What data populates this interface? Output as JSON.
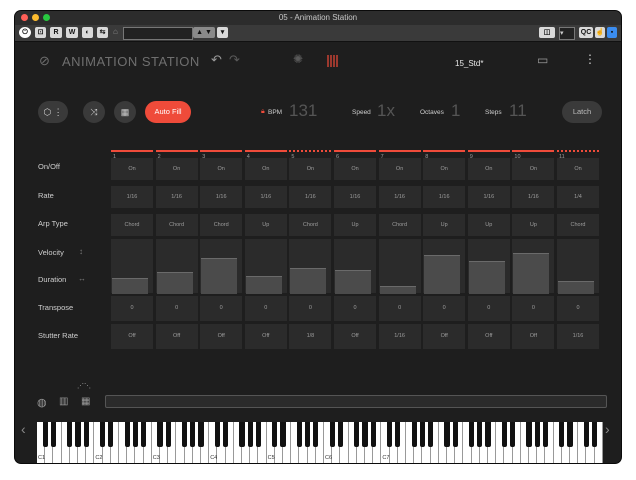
{
  "window": {
    "title": "05 - Animation Station"
  },
  "toolbar": {
    "buttons": [
      "R",
      "W"
    ],
    "qc_label": "QC"
  },
  "header": {
    "app_name": "ANIMATION STATION",
    "preset_name": "15_Std*"
  },
  "controls": {
    "auto_fill_label": "Auto Fill",
    "latch_label": "Latch",
    "bpm_label": "BPM",
    "bpm_value": "131",
    "speed_label": "Speed",
    "speed_value": "1x",
    "octaves_label": "Octaves",
    "octaves_value": "1",
    "steps_label": "Steps",
    "steps_value": "11"
  },
  "rows": {
    "on_off": "On/Off",
    "rate": "Rate",
    "arp_type": "Arp Type",
    "velocity": "Velocity",
    "duration": "Duration",
    "transpose": "Transpose",
    "stutter_rate": "Stutter Rate"
  },
  "steps": [
    {
      "num": "1",
      "on": "On",
      "rate": "1/16",
      "arp": "Chord",
      "velocity": 0.28,
      "transpose": "0",
      "stutter": "Off"
    },
    {
      "num": "2",
      "on": "On",
      "rate": "1/16",
      "arp": "Chord",
      "velocity": 0.4,
      "transpose": "0",
      "stutter": "Off"
    },
    {
      "num": "3",
      "on": "On",
      "rate": "1/16",
      "arp": "Chord",
      "velocity": 0.68,
      "transpose": "0",
      "stutter": "Off"
    },
    {
      "num": "4",
      "on": "On",
      "rate": "1/16",
      "arp": "Up",
      "velocity": 0.32,
      "transpose": "0",
      "stutter": "Off"
    },
    {
      "num": "5",
      "on": "On",
      "rate": "1/16",
      "arp": "Chord",
      "velocity": 0.48,
      "transpose": "0",
      "stutter": "1/8"
    },
    {
      "num": "6",
      "on": "On",
      "rate": "1/16",
      "arp": "Up",
      "velocity": 0.44,
      "transpose": "0",
      "stutter": "Off"
    },
    {
      "num": "7",
      "on": "On",
      "rate": "1/16",
      "arp": "Chord",
      "velocity": 0.14,
      "transpose": "0",
      "stutter": "1/16"
    },
    {
      "num": "8",
      "on": "On",
      "rate": "1/16",
      "arp": "Up",
      "velocity": 0.74,
      "transpose": "0",
      "stutter": "Off"
    },
    {
      "num": "9",
      "on": "On",
      "rate": "1/16",
      "arp": "Up",
      "velocity": 0.62,
      "transpose": "0",
      "stutter": "Off"
    },
    {
      "num": "10",
      "on": "On",
      "rate": "1/16",
      "arp": "Up",
      "velocity": 0.76,
      "transpose": "0",
      "stutter": "Off"
    },
    {
      "num": "11",
      "on": "On",
      "rate": "1/4",
      "arp": "Chord",
      "velocity": 0.24,
      "transpose": "0",
      "stutter": "1/16"
    }
  ],
  "keyboard": {
    "labels": [
      "C1",
      "C2",
      "C3",
      "C4",
      "C5",
      "C6",
      "C7"
    ]
  },
  "colors": {
    "accent": "#ef4b3a",
    "background": "#1e1e1e",
    "cell": "#2b2b2b"
  }
}
